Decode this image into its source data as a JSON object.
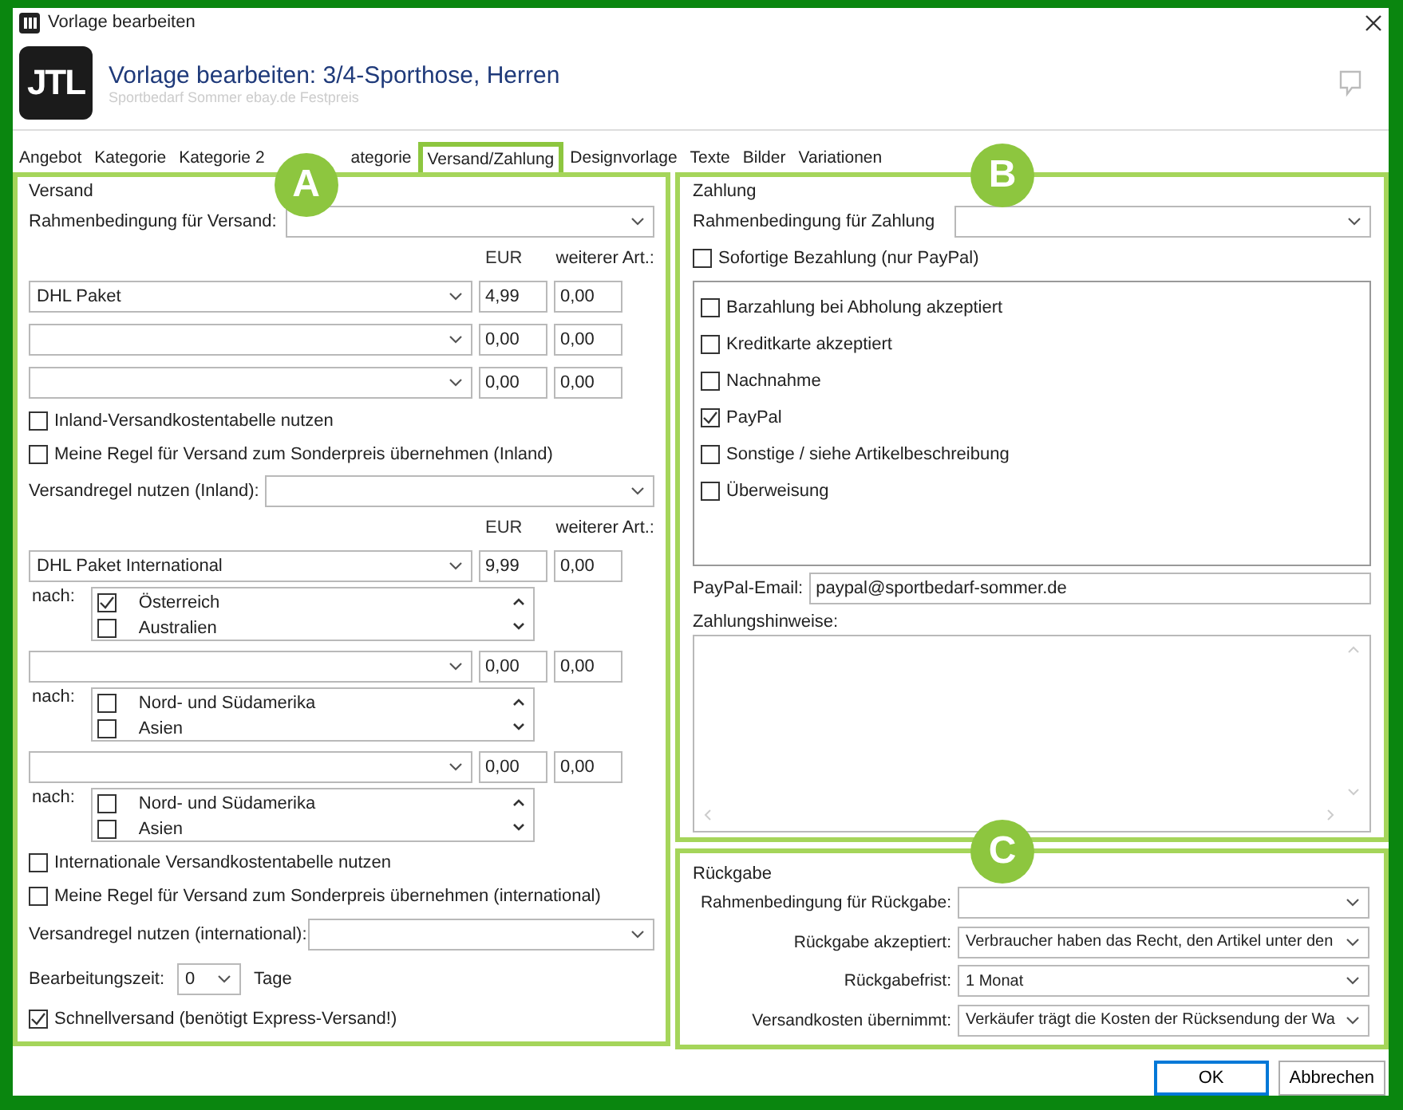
{
  "window": {
    "title": "Vorlage bearbeiten"
  },
  "header": {
    "logo": "JTL",
    "title": "Vorlage bearbeiten: 3/4-Sporthose, Herren",
    "subtitle": "Sportbedarf Sommer ebay.de Festpreis"
  },
  "tabs": [
    {
      "label": "Angebot",
      "selected": false
    },
    {
      "label": "Kategorie",
      "selected": false
    },
    {
      "label": "Kategorie 2",
      "selected": false
    },
    {
      "label": "ategorie",
      "selected": false
    },
    {
      "label": "Versand/Zahlung",
      "selected": true
    },
    {
      "label": "Designvorlage",
      "selected": false
    },
    {
      "label": "Texte",
      "selected": false
    },
    {
      "label": "Bilder",
      "selected": false
    },
    {
      "label": "Variationen",
      "selected": false
    }
  ],
  "versand": {
    "badge": "A",
    "legend": "Versand",
    "rahmen_label": "Rahmenbedingung für Versand:",
    "inland": {
      "headers": [
        "EUR",
        "weiterer Art.:"
      ],
      "rows": [
        {
          "service": "DHL Paket",
          "eur": "4,99",
          "weitere": "0,00"
        },
        {
          "eur": "0,00",
          "weitere": "0,00"
        },
        {
          "eur": "0,00",
          "weitere": "0,00"
        }
      ]
    },
    "inland_options": [
      {
        "label": "Inland-Versandkostentabelle nutzen",
        "checked": false
      },
      {
        "label": "Meine Regel für Versand zum Sonderpreis übernehmen (Inland)",
        "checked": false
      }
    ],
    "inland_rule_label": "Versandregel nutzen (Inland):",
    "international": {
      "headers": [
        "EUR",
        "weiterer Art.:"
      ],
      "rows": [
        {
          "service": "DHL Paket International",
          "eur": "9,99",
          "weitere": "0,00",
          "destinations_label": "nach:",
          "destinations": [
            {
              "name": "Österreich",
              "checked": true
            },
            {
              "name": "Australien",
              "checked": false
            }
          ]
        },
        {
          "eur": "0,00",
          "weitere": "0,00",
          "destinations_label": "nach:",
          "destinations": [
            {
              "name": "Nord- und Südamerika",
              "checked": false
            },
            {
              "name": "Asien",
              "checked": false
            }
          ]
        },
        {
          "eur": "0,00",
          "weitere": "0,00",
          "destinations_label": "nach:",
          "destinations": [
            {
              "name": "Nord- und Südamerika",
              "checked": false
            },
            {
              "name": "Asien",
              "checked": false
            }
          ]
        }
      ]
    },
    "international_options": [
      {
        "label": "Internationale Versandkostentabelle nutzen",
        "checked": false
      },
      {
        "label": "Meine Regel für Versand zum Sonderpreis übernehmen (international)",
        "checked": false
      }
    ],
    "international_rule_label": "Versandregel nutzen (international):",
    "processing": {
      "label": "Bearbeitungszeit:",
      "value": "0",
      "unit": "Tage"
    },
    "express": {
      "label": "Schnellversand (benötigt Express-Versand!)",
      "checked": true
    }
  },
  "zahlung": {
    "badge": "B",
    "legend": "Zahlung",
    "rahmen_label": "Rahmenbedingung für Zahlung",
    "instant": {
      "label": "Sofortige Bezahlung (nur PayPal)",
      "checked": false
    },
    "methods": [
      {
        "label": "Barzahlung bei Abholung akzeptiert",
        "checked": false
      },
      {
        "label": "Kreditkarte akzeptiert",
        "checked": false
      },
      {
        "label": "Nachnahme",
        "checked": false
      },
      {
        "label": "PayPal",
        "checked": true
      },
      {
        "label": "Sonstige / siehe Artikelbeschreibung",
        "checked": false
      },
      {
        "label": "Überweisung",
        "checked": false
      }
    ],
    "email_label": "PayPal-Email:",
    "email": "paypal@sportbedarf-sommer.de",
    "notes_label": "Zahlungshinweise:"
  },
  "rueckgabe": {
    "badge": "C",
    "legend": "Rückgabe",
    "rows": [
      {
        "label": "Rahmenbedingung für Rückgabe:"
      },
      {
        "label": "Rückgabe akzeptiert:",
        "value": "Verbraucher haben das Recht, den Artikel unter den"
      },
      {
        "label": "Rückgabefrist:",
        "value": "1 Monat"
      },
      {
        "label": "Versandkosten übernimmt:",
        "value": "Verkäufer trägt die Kosten der Rücksendung der Wa"
      }
    ]
  },
  "buttons": [
    {
      "label": "OK",
      "focused": true
    },
    {
      "label": "Abbrechen",
      "focused": false
    }
  ]
}
